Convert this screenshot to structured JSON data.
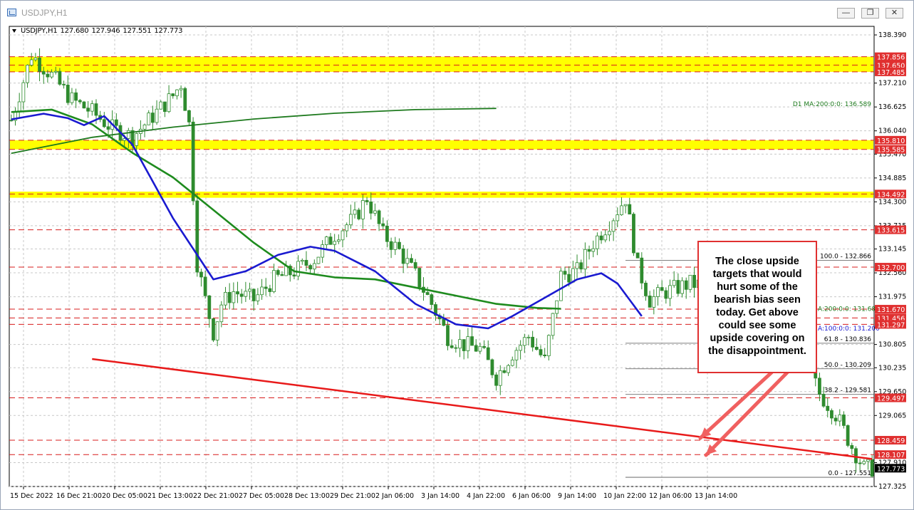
{
  "window": {
    "title": "USDJPY,H1",
    "buttons": [
      "minimize",
      "restore",
      "close"
    ]
  },
  "ohlc": {
    "symbol": "USDJPY,H1",
    "open": "127.680",
    "high": "127.946",
    "low": "127.551",
    "close": "127.773"
  },
  "price_axis": {
    "ticks": [
      "138.390",
      "137.210",
      "136.625",
      "136.040",
      "135.470",
      "134.885",
      "134.300",
      "133.715",
      "133.145",
      "132.560",
      "131.975",
      "130.805",
      "130.235",
      "129.650",
      "129.065",
      "127.910",
      "127.325"
    ],
    "badges": [
      {
        "label": "137.856",
        "color": "#e03030"
      },
      {
        "label": "137.650",
        "color": "#e03030"
      },
      {
        "label": "137.485",
        "color": "#e03030"
      },
      {
        "label": "135.810",
        "color": "#e03030"
      },
      {
        "label": "135.585",
        "color": "#e03030"
      },
      {
        "label": "134.492",
        "color": "#e03030"
      },
      {
        "label": "133.615",
        "color": "#e03030"
      },
      {
        "label": "132.700",
        "color": "#e03030"
      },
      {
        "label": "131.670",
        "color": "#e03030"
      },
      {
        "label": "131.456",
        "color": "#e03030"
      },
      {
        "label": "131.297",
        "color": "#e03030"
      },
      {
        "label": "129.497",
        "color": "#e03030"
      },
      {
        "label": "128.459",
        "color": "#e03030"
      },
      {
        "label": "128.107",
        "color": "#e03030"
      },
      {
        "label": "127.773",
        "color": "#000000"
      }
    ]
  },
  "time_axis": [
    "15 Dec 2022",
    "16 Dec 21:00",
    "20 Dec 05:00",
    "21 Dec 13:00",
    "22 Dec 21:00",
    "27 Dec 05:00",
    "28 Dec 13:00",
    "29 Dec 21:00",
    "2 Jan 06:00",
    "3 Jan 14:00",
    "4 Jan 22:00",
    "6 Jan 06:00",
    "9 Jan 14:00",
    "10 Jan 22:00",
    "12 Jan 06:00",
    "13 Jan 14:00"
  ],
  "indicators": {
    "d1_ma200": "D1 MA:200:0:0: 136.589",
    "ma200": "A:200:0:0: 131.680",
    "ma100": "A:100:0:0: 131.200"
  },
  "fibonacci": [
    "100.0 - 132.866",
    "61.8 - 130.836",
    "50.0 - 130.209",
    "38.2 - 129.581",
    "0.0 - 127.551"
  ],
  "callout": {
    "text": "The close upside targets that would hurt some of the bearish bias seen today. Get above could see some upside covering on the disappointment."
  },
  "colors": {
    "candle": "#2e8b2e",
    "support_zone": "#ffff00",
    "trendline": "#e81a1a",
    "ma200": "#1e8b1e",
    "ma100": "#1a1ad0",
    "d1_ma": "#1e7a1e"
  },
  "chart_data": {
    "type": "candlestick",
    "symbol": "USDJPY",
    "timeframe": "H1",
    "ylim": [
      127.325,
      138.6
    ],
    "close_path": [
      [
        0,
        136.3
      ],
      [
        5,
        137.9
      ],
      [
        10,
        137.4
      ],
      [
        15,
        136.8
      ],
      [
        20,
        136.5
      ],
      [
        25,
        136.1
      ],
      [
        30,
        135.9
      ],
      [
        35,
        136.4
      ],
      [
        40,
        136.9
      ],
      [
        42,
        137.2
      ],
      [
        44,
        136.2
      ],
      [
        46,
        132.8
      ],
      [
        48,
        131.9
      ],
      [
        50,
        131.1
      ],
      [
        52,
        131.8
      ],
      [
        55,
        132.1
      ],
      [
        60,
        131.9
      ],
      [
        65,
        132.4
      ],
      [
        70,
        132.6
      ],
      [
        75,
        132.9
      ],
      [
        80,
        133.5
      ],
      [
        85,
        133.9
      ],
      [
        88,
        134.4
      ],
      [
        92,
        133.5
      ],
      [
        96,
        133.1
      ],
      [
        100,
        132.5
      ],
      [
        104,
        131.8
      ],
      [
        108,
        131.0
      ],
      [
        112,
        130.8
      ],
      [
        116,
        130.7
      ],
      [
        120,
        130.0
      ],
      [
        124,
        130.6
      ],
      [
        128,
        131.0
      ],
      [
        132,
        130.4
      ],
      [
        136,
        132.5
      ],
      [
        140,
        132.6
      ],
      [
        144,
        133.3
      ],
      [
        148,
        133.8
      ],
      [
        152,
        134.4
      ],
      [
        155,
        132.7
      ],
      [
        158,
        131.9
      ],
      [
        162,
        132.1
      ],
      [
        168,
        132.3
      ],
      [
        174,
        132.2
      ],
      [
        180,
        132.5
      ],
      [
        185,
        132.9
      ],
      [
        188,
        132.3
      ],
      [
        192,
        131.4
      ],
      [
        196,
        130.5
      ],
      [
        200,
        129.6
      ],
      [
        204,
        129.1
      ],
      [
        208,
        128.3
      ],
      [
        211,
        127.773
      ]
    ],
    "ma100": [
      [
        0,
        136.32
      ],
      [
        8,
        136.46
      ],
      [
        14,
        136.35
      ],
      [
        18,
        136.18
      ],
      [
        23,
        136.4
      ],
      [
        30,
        135.7
      ],
      [
        40,
        133.9
      ],
      [
        50,
        132.4
      ],
      [
        58,
        132.6
      ],
      [
        66,
        133.0
      ],
      [
        74,
        133.2
      ],
      [
        80,
        133.1
      ],
      [
        90,
        132.6
      ],
      [
        100,
        131.8
      ],
      [
        110,
        131.3
      ],
      [
        118,
        131.2
      ],
      [
        124,
        131.5
      ],
      [
        132,
        131.95
      ],
      [
        140,
        132.4
      ],
      [
        146,
        132.55
      ],
      [
        150,
        132.3
      ],
      [
        156,
        131.5
      ]
    ],
    "ma200": [
      [
        0,
        136.5
      ],
      [
        10,
        136.56
      ],
      [
        20,
        136.2
      ],
      [
        30,
        135.5
      ],
      [
        40,
        134.9
      ],
      [
        50,
        134.1
      ],
      [
        60,
        133.3
      ],
      [
        70,
        132.6
      ],
      [
        80,
        132.45
      ],
      [
        90,
        132.4
      ],
      [
        100,
        132.2
      ],
      [
        110,
        132.0
      ],
      [
        120,
        131.8
      ],
      [
        130,
        131.7
      ],
      [
        136,
        131.68
      ]
    ],
    "d1_ma200": [
      [
        0,
        135.49
      ],
      [
        20,
        135.88
      ],
      [
        40,
        136.13
      ],
      [
        60,
        136.33
      ],
      [
        80,
        136.47
      ],
      [
        100,
        136.56
      ],
      [
        120,
        136.589
      ]
    ],
    "horizontal_levels": [
      137.856,
      137.65,
      137.485,
      135.81,
      135.585,
      134.492,
      133.615,
      132.7,
      131.67,
      131.456,
      131.297,
      129.497,
      128.459,
      128.107
    ],
    "fib_levels": [
      132.866,
      130.836,
      130.209,
      129.581,
      127.551
    ],
    "trendline": [
      [
        20,
        130.45
      ],
      [
        213,
        128.0
      ]
    ]
  }
}
